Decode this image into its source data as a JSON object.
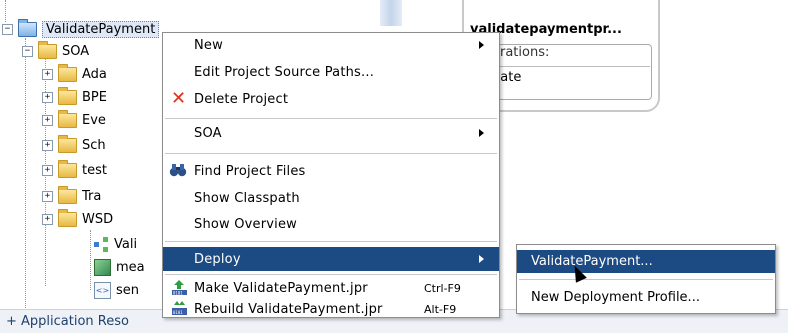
{
  "tree": {
    "project": "ValidatePayment",
    "soa": "SOA",
    "children": [
      "Ada",
      "BPE",
      "Eve",
      "Sch",
      "test",
      "Tra",
      "WSD"
    ],
    "files": [
      "Vali",
      "mea",
      "sen"
    ],
    "app_resources": "Application Reso"
  },
  "component": {
    "title": "validatepaymentpr...",
    "ops_header": "erations:",
    "op": "date"
  },
  "context_menu": {
    "items": [
      {
        "label": "New",
        "mnemonic_index": 0,
        "submenu": true
      },
      {
        "label": "Edit Project Source Paths...",
        "submenu": false
      },
      {
        "label": "Delete Project",
        "submenu": false
      },
      {
        "label": "SOA",
        "submenu": true
      },
      {
        "label": "Find Project Files",
        "submenu": false
      },
      {
        "label": "Show Classpath",
        "submenu": false
      },
      {
        "label": "Show Overview",
        "submenu": false
      },
      {
        "label": "Deploy",
        "submenu": true
      },
      {
        "label": "Make ValidatePayment.jpr",
        "shortcut": "Ctrl-F9"
      },
      {
        "label": "Rebuild ValidatePayment.jpr",
        "shortcut": "Alt-F9"
      }
    ]
  },
  "deploy_submenu": {
    "items": [
      "ValidatePayment...",
      "New Deployment Profile..."
    ]
  },
  "colors": {
    "highlight": "#1c4a82",
    "menu_bg": "#ffffff"
  },
  "icons": [
    "expand-minus-icon",
    "expand-plus-icon",
    "folder-icon",
    "project-folder-icon",
    "delete-x-icon",
    "binoculars-icon",
    "make-icon",
    "rebuild-icon"
  ]
}
